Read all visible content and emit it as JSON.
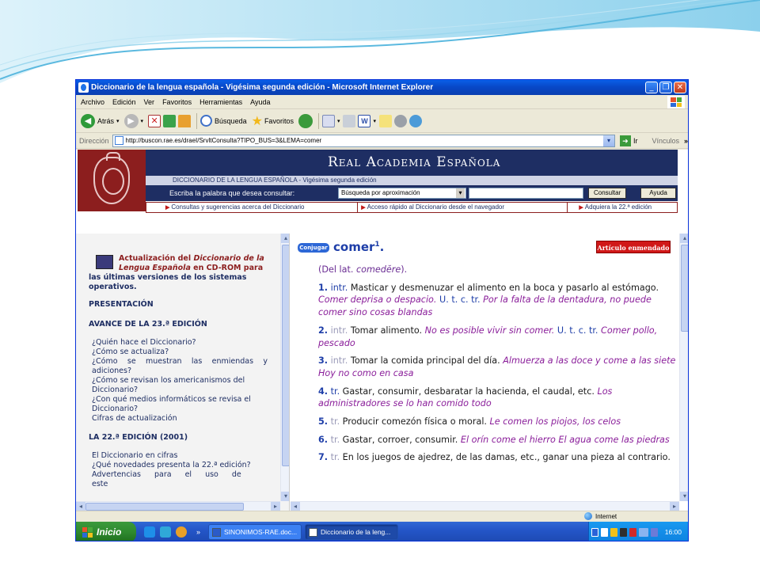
{
  "window": {
    "title": "Diccionario de la lengua española - Vigésima segunda edición - Microsoft Internet Explorer",
    "minimize": "_",
    "maximize": "❐",
    "close": "✕"
  },
  "menu": [
    "Archivo",
    "Edición",
    "Ver",
    "Favoritos",
    "Herramientas",
    "Ayuda"
  ],
  "toolbar": {
    "back": "Atrás",
    "search": "Búsqueda",
    "favorites": "Favoritos"
  },
  "address": {
    "label": "Dirección",
    "url": "http://buscon.rae.es/draeI/SrvltConsulta?TIPO_BUS=3&LEMA=comer",
    "go": "Ir",
    "links": "Vínculos",
    "more": "»"
  },
  "rae": {
    "banner": "Real Academia Española",
    "subtitle": "DICCIONARIO DE LA LENGUA ESPAÑOLA - Vigésima segunda edición",
    "search_label": "Escriba la palabra que desea consultar:",
    "search_mode": "Búsqueda por aproximación",
    "consult_button": "Consultar",
    "help_button": "Ayuda",
    "links": [
      "Consultas y sugerencias acerca del Diccionario",
      "Acceso rápido al Diccionario desde el navegador",
      "Adquiera la 22.ª edición"
    ]
  },
  "sidebar": {
    "cd_title_1": "Actualización del ",
    "cd_title_italic": "Diccionario de la Lengua Española",
    "cd_title_2": " en CD-ROM para",
    "cd_tail": "las últimas versiones de los sistemas operativos.",
    "presentacion": "PRESENTACIÓN",
    "avance": "AVANCE DE LA 23.ª EDICIÓN",
    "avance_links": [
      "¿Quién hace el Diccionario?",
      "¿Cómo se actualiza?",
      "¿Cómo se muestran las enmiendas y adiciones?",
      "¿Cómo se revisan los americanismos del Diccionario?",
      "¿Con qué medios informáticos se revisa el Diccionario?",
      "Cifras de actualización"
    ],
    "ed22": "LA 22.ª EDICIÓN (2001)",
    "ed22_links": [
      "El Diccionario en cifras",
      "¿Qué novedades presenta la 22.ª edición?",
      "Advertencias para el uso de este"
    ]
  },
  "entry": {
    "conjugar": "Conjugar",
    "lemma": "comer",
    "superscript": "1",
    "lemma_suffix": ".",
    "enmendado": "Artículo enmendado",
    "etym_pre": "(Del lat. ",
    "etym_word": "comedĕre",
    "etym_post": ").",
    "acepciones": [
      {
        "num": "1.",
        "abr": "intr.",
        "def": " Masticar y desmenuzar el alimento en la boca y pasarlo al estómago. ",
        "ej": "Comer deprisa o despacio.",
        "extra": " U. t. c. tr. ",
        "ej2": "Por la falta de la dentadura, no puede comer sino cosas blandas"
      },
      {
        "num": "2.",
        "abr": "intr.",
        "def": " Tomar alimento. ",
        "ej": "No es posible vivir sin comer.",
        "extra": " U. t. c. tr. ",
        "ej2": "Comer pollo, pescado"
      },
      {
        "num": "3.",
        "abr": "intr.",
        "def": " Tomar la comida principal del día. ",
        "ej": "Almuerza a las doce y come a las siete Hoy no como en casa",
        "extra": "",
        "ej2": ""
      },
      {
        "num": "4.",
        "abr": "tr.",
        "def": " Gastar, consumir, desbaratar la hacienda, el caudal, etc. ",
        "ej": "Los administradores se lo han comido todo",
        "extra": "",
        "ej2": ""
      },
      {
        "num": "5.",
        "abr": "tr.",
        "def": " Producir comezón física o moral. ",
        "ej": "Le comen los piojos, los celos",
        "extra": "",
        "ej2": ""
      },
      {
        "num": "6.",
        "abr": "tr.",
        "def": " Gastar, corroer, consumir. ",
        "ej": "El orín come el hierro El agua come las piedras",
        "extra": "",
        "ej2": ""
      },
      {
        "num": "7.",
        "abr": "tr.",
        "def": " En los juegos de ajedrez, de las damas, etc., ganar una pieza al contrario.",
        "ej": "",
        "extra": "",
        "ej2": ""
      }
    ]
  },
  "status": {
    "zone": "Internet"
  },
  "taskbar": {
    "start": "Inicio",
    "quicklaunch_more": "»",
    "tasks": [
      "SINONIMOS-RAE.doc...",
      "Diccionario de la leng..."
    ],
    "clock": "16:00"
  }
}
